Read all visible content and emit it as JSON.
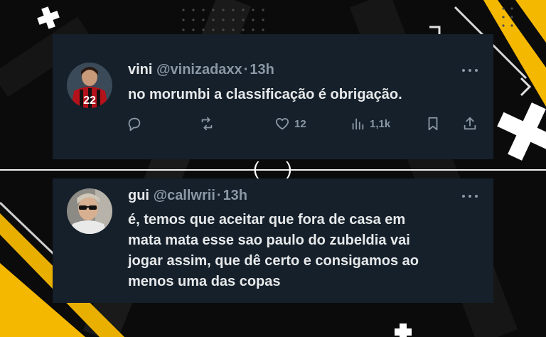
{
  "colors": {
    "card_bg": "#15202b",
    "text_primary": "#e7e9ea",
    "text_secondary": "#8b98a5",
    "accent_yellow": "#f5b800",
    "page_bg": "#0b0b0b"
  },
  "divider": {
    "left_glyph": "(",
    "right_glyph": ")"
  },
  "tweets": [
    {
      "name": "vini",
      "handle": "@vinizadaxx",
      "separator": "·",
      "time": "13h",
      "text": "no morumbi a classificação é obrigação.",
      "avatar_icon": "avatar-player-red-black-jersey",
      "actions": {
        "reply_icon": "reply-icon",
        "retweet_icon": "retweet-icon",
        "like_icon": "heart-icon",
        "like_count": "12",
        "views_icon": "views-icon",
        "view_count": "1,1k",
        "bookmark_icon": "bookmark-icon",
        "share_icon": "share-icon"
      }
    },
    {
      "name": "gui",
      "handle": "@callwrii",
      "separator": "·",
      "time": "13h",
      "text": "é, temos que aceitar que fora de casa em\nmata mata esse sao paulo do zubeldia vai\njogar assim, que dê certo e consigamos ao\nmenos uma das copas",
      "avatar_icon": "avatar-man-sunglasses"
    }
  ]
}
